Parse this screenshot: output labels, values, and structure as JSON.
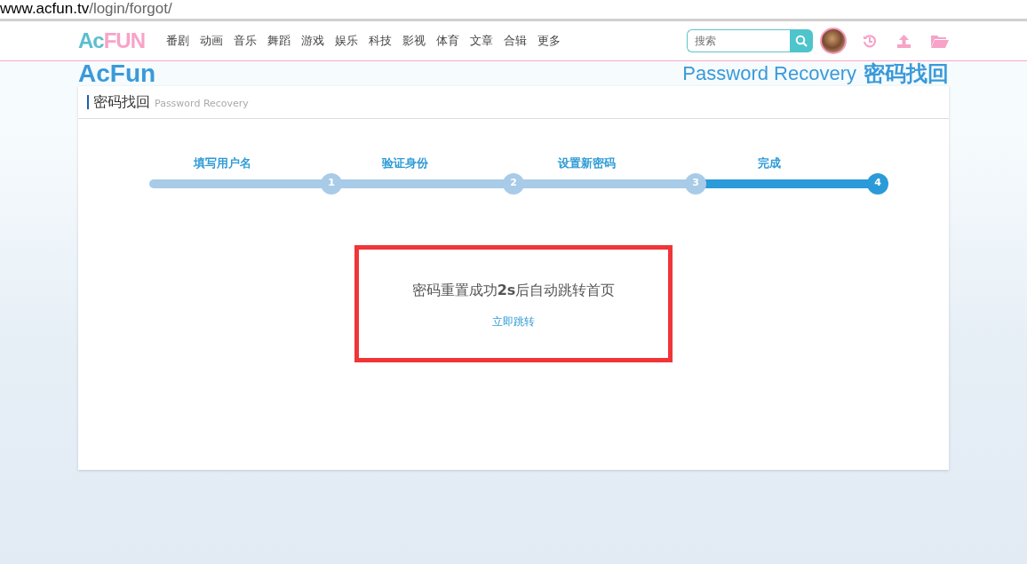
{
  "address_bar": {
    "host": "www.acfun.tv",
    "path": "/login/forgot/"
  },
  "header": {
    "logo": [
      "Ac",
      "FUN"
    ],
    "nav": [
      "番剧",
      "动画",
      "音乐",
      "舞蹈",
      "游戏",
      "娱乐",
      "科技",
      "影视",
      "体育",
      "文章",
      "合辑",
      "更多"
    ],
    "search": {
      "placeholder": "搜索"
    }
  },
  "banner": {
    "left": "AcFun",
    "right": "Password Recovery",
    "right_cn": "密码找回"
  },
  "panel": {
    "title": "密码找回",
    "subtitle": "Password Recovery",
    "steps": [
      {
        "label": "填写用户名",
        "number": "1",
        "selected": false
      },
      {
        "label": "验证身份",
        "number": "2",
        "selected": false
      },
      {
        "label": "设置新密码",
        "number": "3",
        "selected": false
      },
      {
        "label": "完成",
        "number": "4",
        "selected": true
      }
    ],
    "message": "密码重置成功**2s**后自动跳转首页",
    "link": "立即跳转",
    "highlighted": true
  }
}
